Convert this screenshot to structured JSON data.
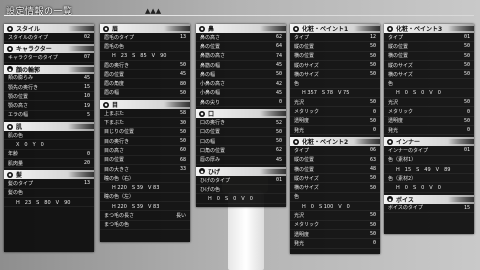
{
  "title": "設定情報の一覧",
  "title_marks": "▲▲▲",
  "panels": {
    "style": {
      "header": "スタイル",
      "rows": [
        [
          "スタイルのタイプ",
          "02"
        ]
      ]
    },
    "character": {
      "header": "キャラクター",
      "rows": [
        [
          "キャラクターのタイプ",
          "07"
        ]
      ]
    },
    "outline": {
      "header": "顔の輪郭",
      "rows": [
        [
          "頬の膨らみ",
          "45"
        ],
        [
          "顎先の奥行き",
          "15"
        ],
        [
          "顎の位置",
          "10"
        ],
        [
          "顎の高さ",
          "19"
        ],
        [
          "エラの幅",
          "5"
        ]
      ]
    },
    "skin": {
      "header": "肌",
      "rows": [
        [
          "肌の色",
          ""
        ],
        [
          "X　0　Y　0",
          ""
        ],
        [
          "年齢",
          "0"
        ],
        [
          "肌肉量",
          "20"
        ]
      ]
    },
    "hair": {
      "header": "髪",
      "rows": [
        [
          "髪のタイプ",
          "13"
        ],
        [
          "髪の色",
          ""
        ],
        [
          "H　23　S　80　V　90",
          ""
        ]
      ]
    },
    "brow": {
      "header": "眉",
      "rows": [
        [
          "眉毛のタイプ",
          "13"
        ],
        [
          "眉毛の色",
          ""
        ],
        [
          "H　23　S　85　V　90",
          ""
        ],
        [
          "眉の奥行き",
          "50"
        ],
        [
          "眉の位置",
          "45"
        ],
        [
          "眉の角度",
          "80"
        ],
        [
          "眉の幅",
          "50"
        ]
      ]
    },
    "eye": {
      "header": "目",
      "rows": [
        [
          "上まぶた",
          "58"
        ],
        [
          "下まぶた",
          "30"
        ],
        [
          "目じりの位置",
          "50"
        ],
        [
          "目の奥行き",
          "50"
        ],
        [
          "目の高さ",
          "60"
        ],
        [
          "目の位置",
          "68"
        ],
        [
          "目の大きさ",
          "33"
        ],
        [
          "瞳の色（右）",
          ""
        ],
        [
          "H 220　S 39　V 83",
          ""
        ],
        [
          "瞳の色（左）",
          ""
        ],
        [
          "H 220　S 39　V 83",
          ""
        ],
        [
          "まつ毛の長さ",
          "長い"
        ],
        [
          "まつ毛の色",
          ""
        ]
      ]
    },
    "nose": {
      "header": "鼻",
      "rows": [
        [
          "鼻の高さ",
          "62"
        ],
        [
          "鼻の位置",
          "64"
        ],
        [
          "鼻筋の高さ",
          "74"
        ],
        [
          "鼻筋の幅",
          "45"
        ],
        [
          "鼻の幅",
          "50"
        ],
        [
          "小鼻の高さ",
          "42"
        ],
        [
          "小鼻の幅",
          "45"
        ],
        [
          "鼻の尖り",
          "0"
        ]
      ]
    },
    "mouth": {
      "header": "口",
      "rows": [
        [
          "口の奥行き",
          "52"
        ],
        [
          "口の位置",
          "50"
        ],
        [
          "口の幅",
          "50"
        ],
        [
          "口角の位置",
          "62"
        ],
        [
          "唇の厚み",
          "45"
        ]
      ]
    },
    "beard": {
      "header": "ひげ",
      "rows": [
        [
          "ひげのタイプ",
          "01"
        ],
        [
          "ひげの色",
          ""
        ],
        [
          "H　0　S　0　V　0",
          ""
        ]
      ]
    },
    "makeup1": {
      "header": "化粧・ペイント1",
      "rows": [
        [
          "タイプ",
          "12"
        ],
        [
          "縦の位置",
          "50"
        ],
        [
          "横の位置",
          "50"
        ],
        [
          "縦のサイズ",
          "50"
        ],
        [
          "横のサイズ",
          "50"
        ],
        [
          "色",
          ""
        ],
        [
          "H 357　S 78　V 75",
          ""
        ],
        [
          "光沢",
          "50"
        ],
        [
          "メタリック",
          "0"
        ],
        [
          "透明度",
          "50"
        ],
        [
          "発光",
          "0"
        ]
      ]
    },
    "makeup2": {
      "header": "化粧・ペイント2",
      "rows": [
        [
          "タイプ",
          "06"
        ],
        [
          "縦の位置",
          "63"
        ],
        [
          "横の位置",
          "48"
        ],
        [
          "縦のサイズ",
          "50"
        ],
        [
          "横のサイズ",
          "50"
        ],
        [
          "色",
          ""
        ],
        [
          "H　0　S 100　V　0",
          ""
        ],
        [
          "光沢",
          "50"
        ],
        [
          "メタリック",
          "50"
        ],
        [
          "透明度",
          "50"
        ],
        [
          "発光",
          "0"
        ]
      ]
    },
    "makeup3": {
      "header": "化粧・ペイント3",
      "rows": [
        [
          "タイプ",
          "01"
        ],
        [
          "縦の位置",
          "50"
        ],
        [
          "横の位置",
          "50"
        ],
        [
          "縦のサイズ",
          "50"
        ],
        [
          "横のサイズ",
          "50"
        ],
        [
          "色",
          ""
        ],
        [
          "H　0　S　0　V　0",
          ""
        ],
        [
          "光沢",
          "50"
        ],
        [
          "メタリック",
          "0"
        ],
        [
          "透明度",
          "50"
        ],
        [
          "発光",
          "0"
        ]
      ]
    },
    "inner": {
      "header": "インナー",
      "rows": [
        [
          "インナーのタイプ",
          "01"
        ],
        [
          "色（素材1）",
          ""
        ],
        [
          "H　15　S　49　V　89",
          ""
        ],
        [
          "色（素材2）",
          ""
        ],
        [
          "H　0　S　0　V　0",
          ""
        ]
      ]
    },
    "voice": {
      "header": "ボイス",
      "rows": [
        [
          "ボイスのタイプ",
          "15"
        ]
      ]
    }
  }
}
